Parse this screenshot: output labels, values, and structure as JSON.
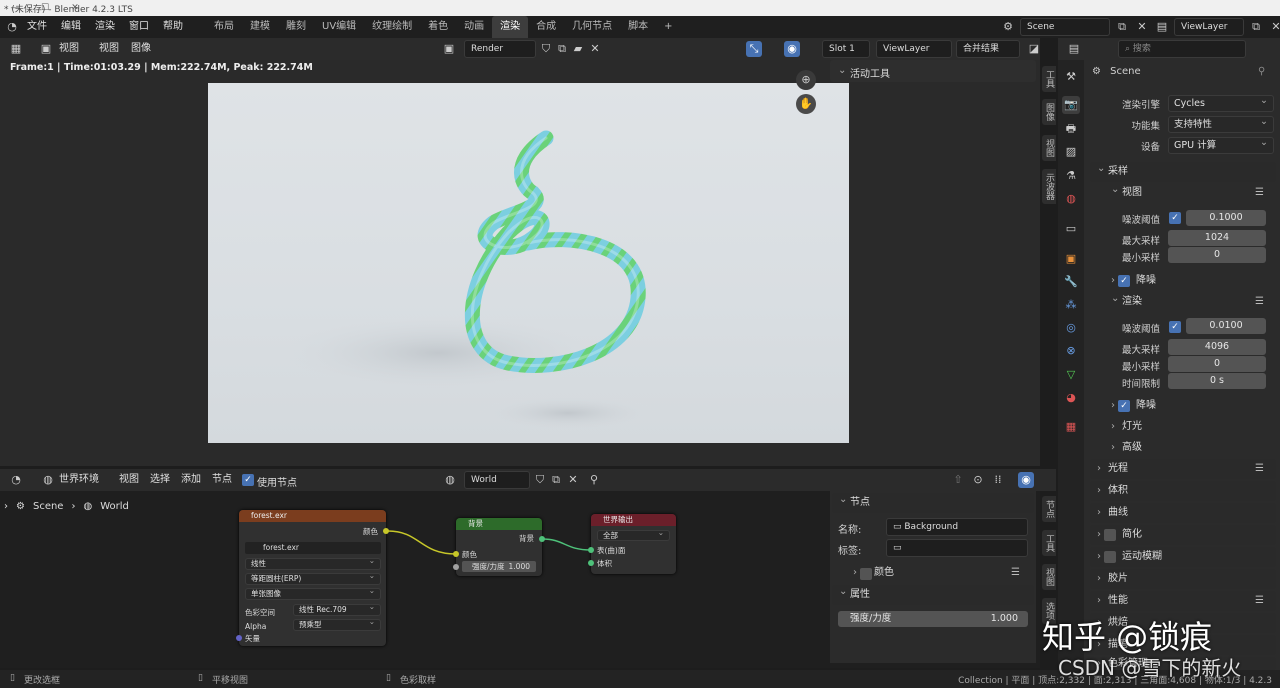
{
  "titlebar": {
    "title": "* (未保存) - Blender 4.2.3 LTS",
    "minimize": "—",
    "maximize": "☐",
    "close": "✕"
  },
  "menu": [
    "文件",
    "编辑",
    "渲染",
    "窗口",
    "帮助"
  ],
  "workspaces": [
    "布局",
    "建模",
    "雕刻",
    "UV编辑",
    "纹理绘制",
    "着色",
    "动画",
    "渲染",
    "合成",
    "几何节点",
    "脚本"
  ],
  "workspace_add": "+",
  "scene_field": "Scene",
  "viewlayer_field": "ViewLayer",
  "image_editor": {
    "menu": [
      "视图",
      "视图",
      "图像"
    ],
    "image_name": "Render Result",
    "slot": "Slot 1",
    "layer": "ViewLayer",
    "pass": "合并结果",
    "status_line": "Frame:1 | Time:01:03.29 | Mem:222.74M, Peak: 222.74M",
    "sidebar_title": "活动工具",
    "vtabs": [
      "工具",
      "图像",
      "视图",
      "示波器"
    ]
  },
  "properties": {
    "search_placeholder": "搜索",
    "scene_label": "Scene",
    "render_engine_label": "渲染引擎",
    "render_engine": "Cycles",
    "feature_set_label": "功能集",
    "feature_set": "支持特性",
    "device_label": "设备",
    "device": "GPU 计算",
    "sampling_label": "采样",
    "viewport_label": "视图",
    "noise_threshold_label": "噪波阈值",
    "viewport_noise_threshold": "0.1000",
    "max_samples_label": "最大采样",
    "viewport_max_samples": "1024",
    "min_samples_label": "最小采样",
    "viewport_min_samples": "0",
    "denoise_label": "降噪",
    "render_label": "渲染",
    "render_noise_threshold": "0.0100",
    "render_max_samples": "4096",
    "render_min_samples": "0",
    "time_limit_label": "时间限制",
    "time_limit": "0 s",
    "lights_label": "灯光",
    "advanced_label": "高级",
    "light_paths_label": "光程",
    "volumes_label": "体积",
    "curves_label": "曲线",
    "simplify_label": "简化",
    "motion_blur_label": "运动模糊",
    "film_label": "胶片",
    "performance_label": "性能",
    "bake_label": "烘焙",
    "freestyle_label": "描笔",
    "color_mgmt_label": "色彩管理"
  },
  "node_editor": {
    "type": "世界环境",
    "menu": [
      "视图",
      "选择",
      "添加",
      "节点"
    ],
    "use_nodes_label": "使用节点",
    "world_name": "World",
    "breadcrumb": [
      "Scene",
      "World"
    ],
    "sidebar": {
      "node_label": "节点",
      "name_label": "名称:",
      "name_value": "Background",
      "tag_label": "标签:",
      "tag_value": "",
      "color_label": "颜色",
      "props_label": "属性",
      "strength_label": "强度/力度",
      "strength_value": "1.000"
    },
    "vtabs": [
      "节点",
      "工具",
      "视图",
      "选项"
    ],
    "nodes": {
      "env": {
        "title": "forest.exr",
        "out_color": "颜色",
        "image": "forest.exr",
        "interp": "线性",
        "proj": "等距圆柱(ERP)",
        "ext": "单张图像",
        "cs_label": "色彩空间",
        "cs_value": "线性 Rec.709",
        "alpha_label": "Alpha",
        "alpha_value": "预乘型",
        "vector_label": "矢量"
      },
      "bg": {
        "title": "背景",
        "out": "背景",
        "color": "颜色",
        "strength_label": "强度/力度",
        "strength_value": "1.000"
      },
      "out": {
        "title": "世界输出",
        "target": "全部",
        "surface": "表(曲)面",
        "volume": "体积"
      }
    }
  },
  "statusbar": {
    "left": "更改选框",
    "middle": "平移视图",
    "right": "色彩取样",
    "stats": "Collection | 平面 | 顶点:2,332 | 面:2,313 | 三角面:4,608 | 物体:1/3 | 4.2.3"
  },
  "watermarks": {
    "zhihu": "知乎 @锁痕",
    "csdn": "CSDN @雪下的新火"
  },
  "colors": {
    "accent": "#4772b3",
    "env_node_header": "#7b3d1e",
    "bg_node_header": "#2d6b2a",
    "out_node_header": "#6b1f2a",
    "render_bg": "#d9dee2",
    "rope_green": "#6ad27a",
    "rope_cyan": "#7ccfe0"
  }
}
